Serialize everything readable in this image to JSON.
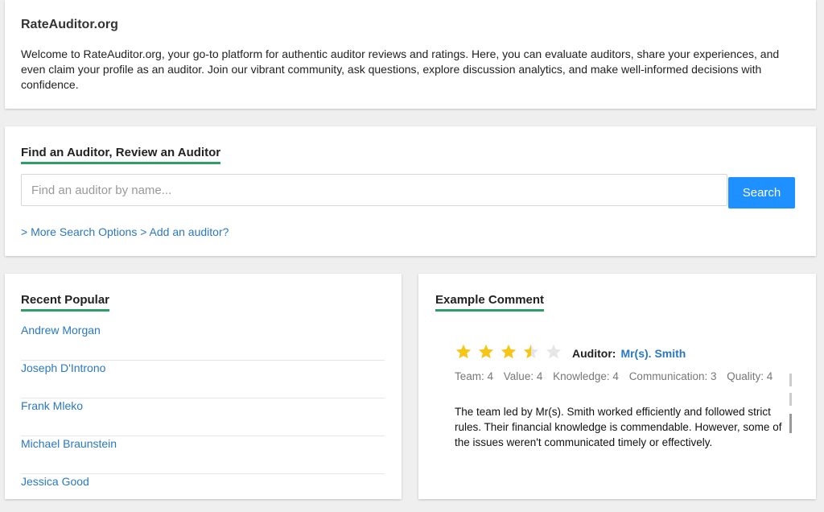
{
  "intro": {
    "title": "RateAuditor.org",
    "text": "Welcome to RateAuditor.org, your go-to platform for authentic auditor reviews and ratings. Here, you can evaluate auditors, share your experiences, and even claim your profile as an auditor. Join our vibrant community, ask questions, explore discussion analytics, and make well-informed decisions with confidence."
  },
  "search": {
    "heading": "Find an Auditor, Review an Auditor",
    "placeholder": "Find an auditor by name...",
    "value": "",
    "button_label": "Search",
    "more_options_link": "> More Search Options",
    "add_auditor_link": "> Add an auditor?"
  },
  "popular": {
    "heading": "Recent Popular",
    "items": [
      "Andrew Morgan",
      "Joseph D'Introno",
      "Frank Mleko",
      "Michael Braunstein",
      "Jessica Good"
    ]
  },
  "comment": {
    "heading": "Example Comment",
    "rating": 3.5,
    "rating_max": 5,
    "auditor_label": "Auditor:",
    "auditor_name": "Mr(s). Smith",
    "scores": [
      "Team: 4",
      "Value: 4",
      "Knowledge: 4",
      "Communication: 3",
      "Quality: 4"
    ],
    "text": "The team led by Mr(s). Smith worked efficiently and followed strict rules. Their financial knowledge is commendable. However, some of the issues weren't communicated timely or effectively."
  },
  "colors": {
    "accent_underline": "#2e9e6b",
    "link": "#2a78c2",
    "search_button": "#1e90ff",
    "star_filled": "#f5c518",
    "star_empty": "#e6e6e6"
  },
  "icons": {
    "star": "star-icon"
  }
}
